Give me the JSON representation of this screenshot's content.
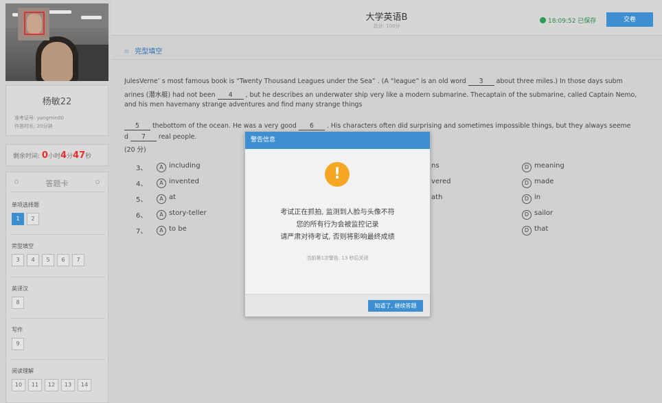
{
  "candidate": {
    "name": "杨敏22",
    "exam_id": "准考证号: yangmin00",
    "duration": "作答时长: 20分钟"
  },
  "timer": {
    "label": "剩余时间:",
    "hours": "0",
    "hours_unit": "小时",
    "minutes": "4",
    "minutes_unit": "分",
    "seconds": "47",
    "seconds_unit": "秒"
  },
  "answer_sheet": {
    "title": "答题卡",
    "sections": [
      {
        "title": "单项选择题",
        "items": [
          "1",
          "2"
        ]
      },
      {
        "title": "完型填空",
        "items": [
          "3",
          "4",
          "5",
          "6",
          "7"
        ]
      },
      {
        "title": "英译汉",
        "items": [
          "8"
        ]
      },
      {
        "title": "写作",
        "items": [
          "9"
        ]
      },
      {
        "title": "阅读理解",
        "items": [
          "10",
          "11",
          "12",
          "13",
          "14"
        ]
      }
    ],
    "active_item": "1"
  },
  "header": {
    "title": "大学英语B",
    "subtitle": "总分: 100分",
    "saved_status": "18:09:52 已保存",
    "submit_label": "交卷"
  },
  "question": {
    "section_title": "完型填空",
    "line1_a": "JulesVerne’ s most famous book is “Twenty Thousand Leagues under the Sea” . (A “league” is an old word",
    "blank3": "3",
    "line1_b": "about three miles.) In those days subm",
    "line2_a": "arines (潜水艇) had not been",
    "blank4": "4",
    "line2_b": ", but he describes an underwater ship very like a modern submarine. Thecaptain of the submarine, called Captain Nemo,",
    "line3": "and his men havemany strange adventures and find many strange things",
    "blank5": "5",
    "line4_a": "thebottom of the ocean. He was a very good",
    "blank6": "6",
    "line4_b": ". His characters often did surprising and sometimes impossible things, but they always seeme",
    "line5_a": "d",
    "blank7": "7",
    "line5_b": "real people.",
    "score": "(20 分)",
    "options": [
      {
        "num": "3、",
        "a": "including",
        "c": "ns",
        "d": "meaning"
      },
      {
        "num": "4、",
        "a": "invented",
        "c": "vered",
        "d": "made"
      },
      {
        "num": "5、",
        "a": "at",
        "c": "ath",
        "d": "in"
      },
      {
        "num": "6、",
        "a": "story-teller",
        "c": "",
        "d": "sailor"
      },
      {
        "num": "7、",
        "a": "to be",
        "c": "",
        "d": "that"
      }
    ],
    "letter_a": "A",
    "letter_d": "D"
  },
  "modal": {
    "title": "警告信息",
    "icon": "exclamation-icon",
    "line1": "考试正在抓拍, 监测到人脸与头像不符",
    "line2": "您的所有行为会被监控记录",
    "line3": "请严肃对待考试, 否则将影响最终成绩",
    "notice": "当前第1次警告, 13 秒后关闭",
    "button": "知道了, 继续答题"
  },
  "colors": {
    "accent": "#3d8fd1",
    "timer_red": "#e3302d",
    "saved_green": "#2b9b55",
    "warning_orange": "#f5a623"
  }
}
